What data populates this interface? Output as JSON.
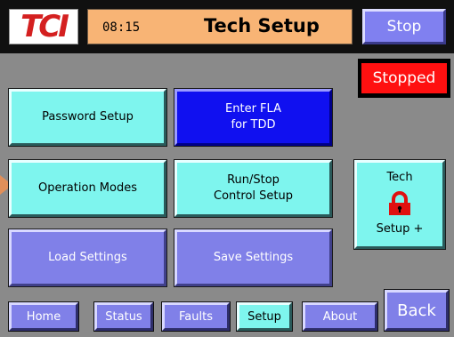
{
  "header": {
    "logo": "TCI",
    "clock": "08:15",
    "title": "Tech Setup",
    "stop_label": "Stop"
  },
  "status": {
    "label": "Stopped",
    "color": "#ff1010"
  },
  "buttons": {
    "password": "Password Setup",
    "fla_line1": "Enter FLA",
    "fla_line2": "for TDD",
    "operation_modes": "Operation Modes",
    "runstop_line1": "Run/Stop",
    "runstop_line2": "Control Setup",
    "load": "Load Settings",
    "save": "Save Settings",
    "tech_line1": "Tech",
    "tech_line2": "Setup +"
  },
  "nav": {
    "home": "Home",
    "status": "Status",
    "faults": "Faults",
    "setup": "Setup",
    "about": "About",
    "back": "Back"
  },
  "icons": {
    "lock": "lock-icon",
    "pointer": "arrow-pointer-icon"
  },
  "colors": {
    "title_bar": "#f8b475",
    "cyan_button": "#7ef5ee",
    "blue_button": "#1010f0",
    "lavender_button": "#8080e8",
    "logo_red": "#d42020"
  }
}
